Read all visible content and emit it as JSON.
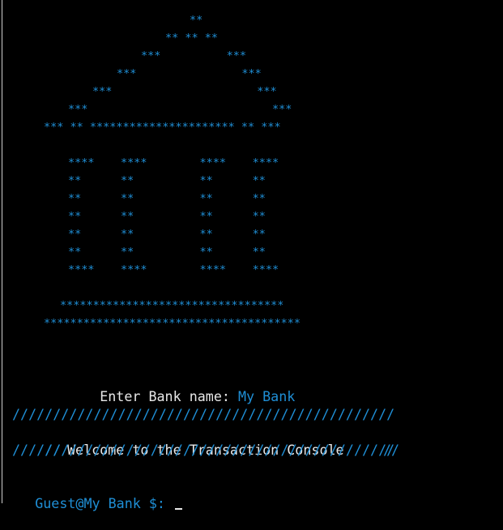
{
  "bank_art": [
    "                  **",
    "               ** ** **",
    "            ***          ***",
    "         ***                ***",
    "      ***                      ***",
    "   ***                            ***",
    "*** ** ********************** ** ***",
    "",
    "   ****    ****        ****    ****",
    "    **      **          **      **",
    "    **      **          **      **",
    "    **      **          **      **",
    "    **      **          **      **",
    "    **      **          **      **",
    "   ****    ****        ****    ****",
    "",
    "  **********************************",
    "***************************************"
  ],
  "prompt": {
    "label": "Enter Bank name: ",
    "value": "My Bank"
  },
  "banner": {
    "top": "///////////////////////////////////////////////",
    "middle_left": "//",
    "title": "Welcome to the Transaction Console",
    "middle_right": "//",
    "bottom": "///////////////////////////////////////////////"
  },
  "shell": {
    "prompt": "Guest@My Bank $: "
  },
  "colors": {
    "background": "#000000",
    "accent": "#1f8fd6",
    "text": "#e8e8e8"
  }
}
